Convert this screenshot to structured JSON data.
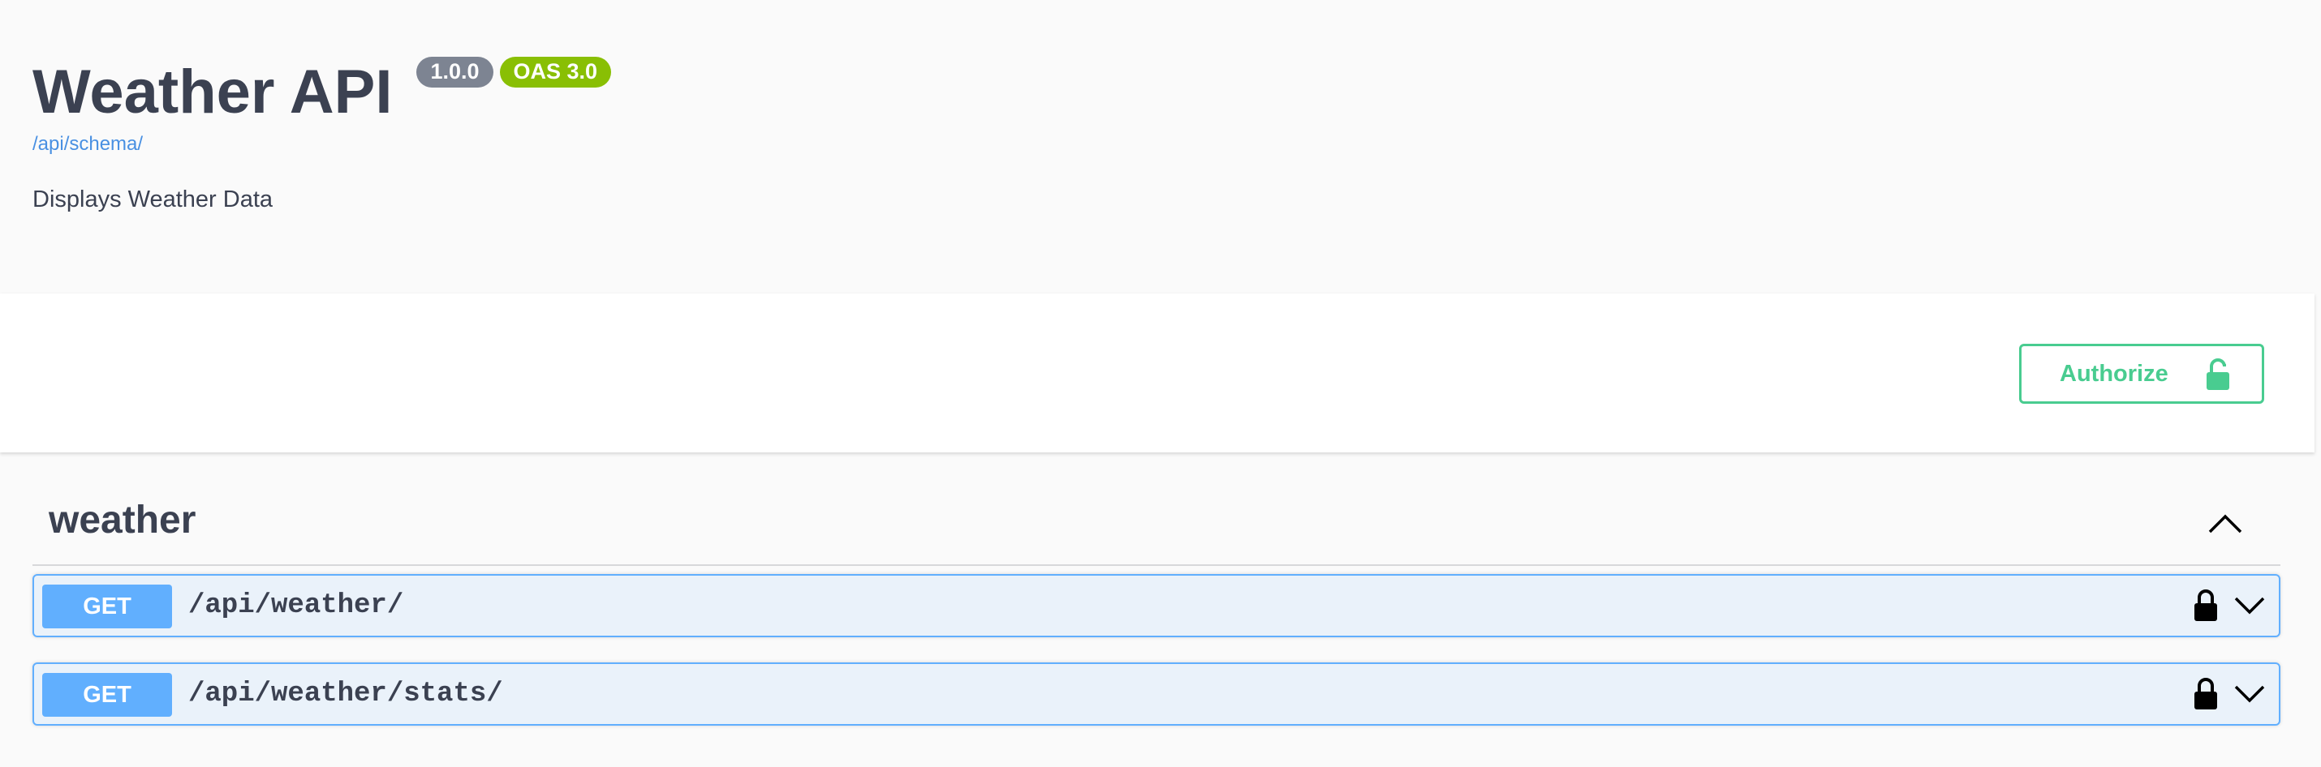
{
  "info": {
    "title": "Weather API",
    "version_badge": "1.0.0",
    "oas_badge": "OAS 3.0",
    "schema_link": "/api/schema/",
    "description": "Displays Weather Data"
  },
  "scheme": {
    "authorize_label": "Authorize"
  },
  "tag": {
    "name": "weather",
    "operations": [
      {
        "method": "GET",
        "path": "/api/weather/"
      },
      {
        "method": "GET",
        "path": "/api/weather/stats/"
      }
    ]
  },
  "colors": {
    "get_method": "#61affe",
    "authorize_green": "#49cc90",
    "version_badge": "#7d8492",
    "oas_badge": "#89bf04",
    "link": "#4990e2",
    "text": "#3b4151"
  },
  "icons": {
    "authorize": "unlocked-icon",
    "operation_lock": "lock-icon",
    "collapse": "chevron-up-icon",
    "expand": "chevron-down-icon"
  }
}
